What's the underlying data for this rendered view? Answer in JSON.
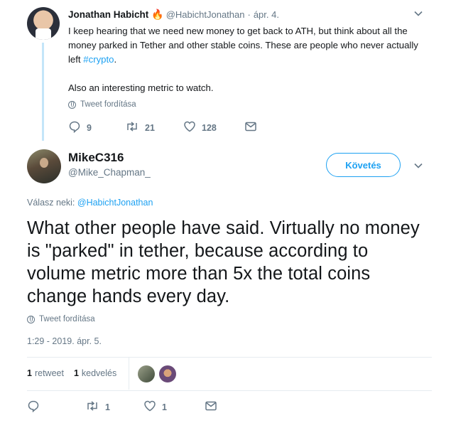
{
  "parent_tweet": {
    "author_name": "Jonathan Habicht",
    "badge": "🔥",
    "handle": "@HabichtJonathan",
    "separator": "·",
    "date": "ápr. 4.",
    "text_line1": "I keep hearing that we need new money to get back to ATH, but think about all the money parked in Tether and other stable coins. These are people who never actually left ",
    "hashtag": "#crypto",
    "text_end": ".",
    "text_line2": "Also an interesting metric to watch.",
    "translate_label": "Tweet fordítása",
    "reply_count": "9",
    "retweet_count": "21",
    "like_count": "128"
  },
  "reply_tweet": {
    "author_name": "MikeC316",
    "handle": "@Mike_Chapman_",
    "follow_label": "Követés",
    "reply_prefix": "Válasz neki:",
    "reply_to_handle": "@HabichtJonathan",
    "text": "What other people have said. Virtually no money is \"parked\" in tether, because according to volume metric more than 5x the total coins change hands every day.",
    "translate_label": "Tweet fordítása",
    "timestamp": "1:29 - 2019. ápr. 5.",
    "retweets_num": "1",
    "retweets_label": "retweet",
    "likes_num": "1",
    "likes_label": "kedvelés",
    "retweet_count": "1",
    "like_count": "1"
  },
  "icons": {
    "reply": "reply-icon",
    "retweet": "retweet-icon",
    "like": "heart-icon",
    "message": "envelope-icon",
    "globe": "globe-icon",
    "chevron": "chevron-down-icon"
  },
  "colors": {
    "accent": "#1da1f2",
    "muted": "#657786",
    "thread_line": "#c4e5f9",
    "text": "#14171a"
  }
}
